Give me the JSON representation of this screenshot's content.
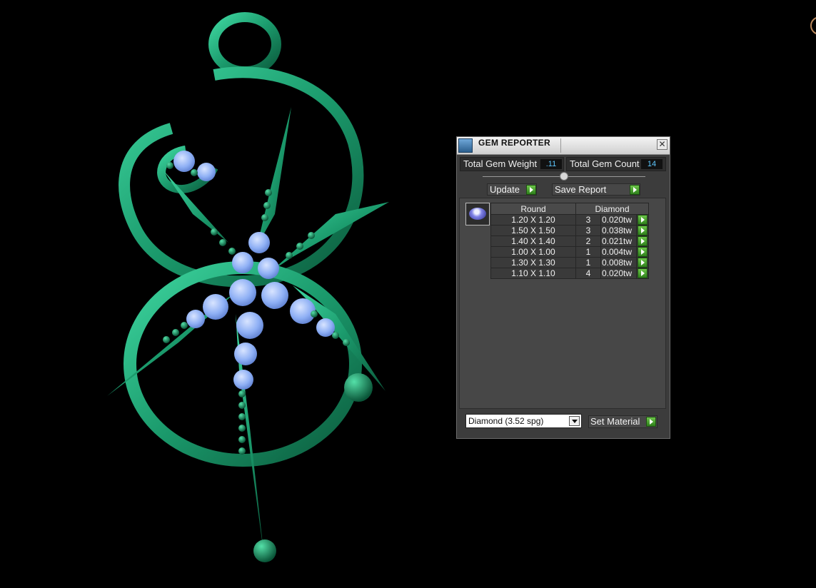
{
  "panel": {
    "title": "GEM REPORTER",
    "close_glyph": "✕",
    "total_weight_label": "Total Gem Weight",
    "total_weight_value": ".11",
    "total_count_label": "Total Gem Count",
    "total_count_value": "14",
    "update_label": "Update",
    "save_report_label": "Save Report",
    "gem_icon": "round-gem-icon",
    "table": {
      "headers": [
        "Round",
        "Diamond"
      ],
      "rows": [
        {
          "size": "1.20 X 1.20",
          "count": "3",
          "weight": "0.020tw"
        },
        {
          "size": "1.50 X 1.50",
          "count": "3",
          "weight": "0.038tw"
        },
        {
          "size": "1.40 X 1.40",
          "count": "2",
          "weight": "0.021tw"
        },
        {
          "size": "1.00 X 1.00",
          "count": "1",
          "weight": "0.004tw"
        },
        {
          "size": "1.30 X 1.30",
          "count": "1",
          "weight": "0.008tw"
        },
        {
          "size": "1.10 X 1.10",
          "count": "4",
          "weight": "0.020tw"
        }
      ]
    },
    "material_selected": "Diamond    (3.52 spg)",
    "set_material_label": "Set Material"
  },
  "colors": {
    "metal": "#1f9a70",
    "gem": "#8fb0f5",
    "panel_bg": "#3c3c3c",
    "accent_value": "#5ec8ff",
    "go_button": "#4aa82c"
  }
}
